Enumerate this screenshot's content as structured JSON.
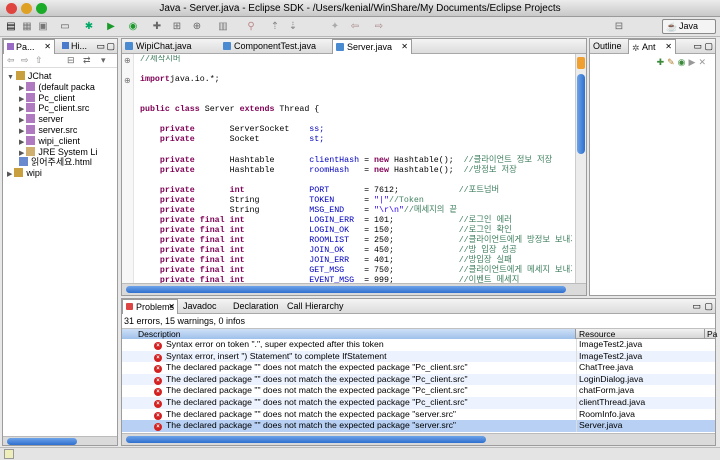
{
  "window": {
    "title": "Java - Server.java - Eclipse SDK - /Users/kenial/WinShare/My Documents/Eclipse Projects"
  },
  "perspective": {
    "label": "Java"
  },
  "left": {
    "tabs": [
      "Pa...",
      "Hi..."
    ],
    "tree": [
      {
        "label": "JChat",
        "indent": 0,
        "expanded": true,
        "icon": "project"
      },
      {
        "label": "(default packa",
        "indent": 1,
        "icon": "package"
      },
      {
        "label": "Pc_client",
        "indent": 1,
        "icon": "package"
      },
      {
        "label": "Pc_client.src",
        "indent": 1,
        "icon": "package"
      },
      {
        "label": "server",
        "indent": 1,
        "icon": "package"
      },
      {
        "label": "server.src",
        "indent": 1,
        "icon": "package"
      },
      {
        "label": "wipi_client",
        "indent": 1,
        "icon": "package"
      },
      {
        "label": "JRE System Li",
        "indent": 1,
        "icon": "library"
      },
      {
        "label": "읽어주세요.html",
        "indent": 1,
        "icon": "file"
      },
      {
        "label": "wipi",
        "indent": 0,
        "icon": "project"
      }
    ]
  },
  "editor": {
    "tabs": [
      "WipiChat.java",
      "ComponentTest.java",
      "Server.java"
    ],
    "active": 2,
    "lines": [
      [
        [
          "cmt",
          "//제작시버"
        ]
      ],
      [],
      [
        [
          "kw",
          "import"
        ],
        [
          "",
          "java.io.*;"
        ]
      ],
      [],
      [],
      [
        [
          "kw",
          "public class"
        ],
        [
          "",
          " Server "
        ],
        [
          "kw",
          "extends"
        ],
        [
          "",
          " Thread {"
        ]
      ],
      [],
      [
        [
          "kw",
          "    private       "
        ],
        [
          "",
          "ServerSocket    "
        ],
        [
          "fld",
          "ss;"
        ]
      ],
      [
        [
          "kw",
          "    private       "
        ],
        [
          "",
          "Socket          "
        ],
        [
          "fld",
          "st;"
        ]
      ],
      [],
      [
        [
          "kw",
          "    private       "
        ],
        [
          "",
          "Hashtable       "
        ],
        [
          "fld",
          "clientHash"
        ],
        [
          "",
          " = "
        ],
        [
          "kw",
          "new"
        ],
        [
          "",
          " Hashtable();  "
        ],
        [
          "cmt",
          "//클라이언트 정보 저장"
        ]
      ],
      [
        [
          "kw",
          "    private       "
        ],
        [
          "",
          "Hashtable       "
        ],
        [
          "fld",
          "roomHash  "
        ],
        [
          "",
          " = "
        ],
        [
          "kw",
          "new"
        ],
        [
          "",
          " Hashtable();  "
        ],
        [
          "cmt",
          "//방정보 저장"
        ]
      ],
      [],
      [
        [
          "kw",
          "    private       int             "
        ],
        [
          "fld",
          "PORT      "
        ],
        [
          "",
          " = 7612;            "
        ],
        [
          "cmt",
          "//포트넘버"
        ]
      ],
      [
        [
          "kw",
          "    private       "
        ],
        [
          "",
          "String          "
        ],
        [
          "fld",
          "TOKEN     "
        ],
        [
          "",
          " = "
        ],
        [
          "str",
          "\"|\""
        ],
        [
          ";              "
        ],
        [
          "cmt",
          "//Token"
        ]
      ],
      [
        [
          "kw",
          "    private       "
        ],
        [
          "",
          "String          "
        ],
        [
          "fld",
          "MSG_END   "
        ],
        [
          "",
          " = "
        ],
        [
          "str",
          "\"\\r\\n\""
        ],
        [
          ";           "
        ],
        [
          "cmt",
          "//메세지의 끝"
        ]
      ],
      [
        [
          "kw",
          "    private final int             "
        ],
        [
          "fld",
          "LOGIN_ERR "
        ],
        [
          "",
          " = 101;             "
        ],
        [
          "cmt",
          "//로그인 에러"
        ]
      ],
      [
        [
          "kw",
          "    private final int             "
        ],
        [
          "fld",
          "LOGIN_OK  "
        ],
        [
          "",
          " = 150;             "
        ],
        [
          "cmt",
          "//로그인 확인"
        ]
      ],
      [
        [
          "kw",
          "    private final int             "
        ],
        [
          "fld",
          "ROOMLIST  "
        ],
        [
          "",
          " = 250;             "
        ],
        [
          "cmt",
          "//클라이언트에게 방정보 보내기"
        ]
      ],
      [
        [
          "kw",
          "    private final int             "
        ],
        [
          "fld",
          "JOIN_OK   "
        ],
        [
          "",
          " = 450;             "
        ],
        [
          "cmt",
          "//방 입장 성공"
        ]
      ],
      [
        [
          "kw",
          "    private final int             "
        ],
        [
          "fld",
          "JOIN_ERR  "
        ],
        [
          "",
          " = 401;             "
        ],
        [
          "cmt",
          "//방입장 실패"
        ]
      ],
      [
        [
          "kw",
          "    private final int             "
        ],
        [
          "fld",
          "GET_MSG   "
        ],
        [
          "",
          " = 750;             "
        ],
        [
          "cmt",
          "//클라이언트에게 메세지 보내기"
        ]
      ],
      [
        [
          "kw",
          "    private final int             "
        ],
        [
          "fld",
          "EVENT_MSG "
        ],
        [
          "",
          " = 999;             "
        ],
        [
          "cmt",
          "//이벤트 메세지"
        ]
      ]
    ]
  },
  "right": {
    "tabs": [
      "Outline",
      "Ant"
    ]
  },
  "problems": {
    "tabs": [
      "Problems",
      "Javadoc",
      "Declaration",
      "Call Hierarchy"
    ],
    "summary": "31 errors, 15 warnings, 0 infos",
    "columns": [
      "Description",
      "Resource",
      "Pa"
    ],
    "rows": [
      {
        "desc": "Syntax error on token \".\", super expected after this token",
        "res": "ImageTest2.java"
      },
      {
        "desc": "Syntax error, insert \") Statement\" to complete IfStatement",
        "res": "ImageTest2.java"
      },
      {
        "desc": "The declared package \"\" does not match the expected package \"Pc_client.src\"",
        "res": "ChatTree.java"
      },
      {
        "desc": "The declared package \"\" does not match the expected package \"Pc_client.src\"",
        "res": "LoginDialog.java"
      },
      {
        "desc": "The declared package \"\" does not match the expected package \"Pc_client.src\"",
        "res": "chatForm.java"
      },
      {
        "desc": "The declared package \"\" does not match the expected package \"Pc_client.src\"",
        "res": "clientThread.java"
      },
      {
        "desc": "The declared package \"\" does not match the expected package \"server.src\"",
        "res": "RoomInfo.java"
      },
      {
        "desc": "The declared package \"\" does not match the expected package \"server.src\"",
        "res": "Server.java"
      }
    ],
    "selected": 7
  }
}
